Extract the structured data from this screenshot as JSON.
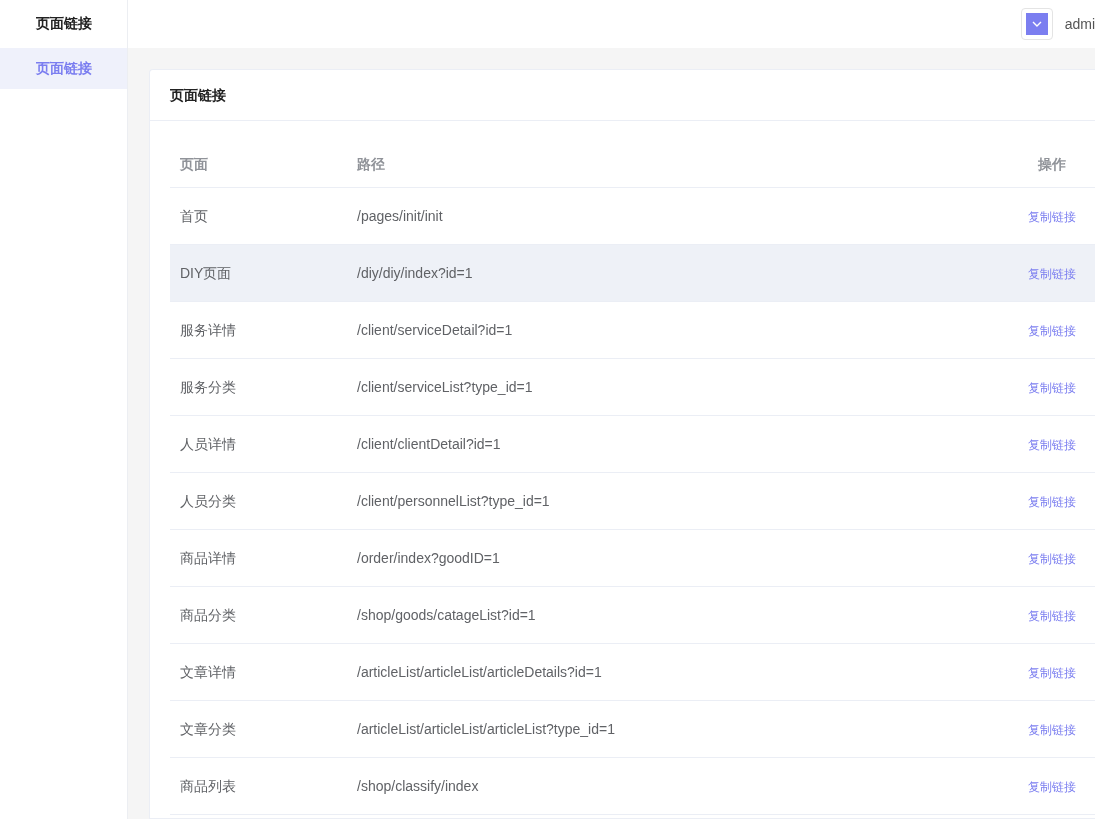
{
  "sidebar": {
    "title": "页面链接",
    "items": [
      {
        "label": "页面链接",
        "selected": true
      }
    ]
  },
  "header": {
    "user": "admi"
  },
  "card": {
    "title": "页面链接",
    "table": {
      "columns": [
        "页面",
        "路径",
        "操作"
      ],
      "rows": [
        {
          "page": "首页",
          "path": "/pages/init/init",
          "action": "复制链接",
          "selected": false
        },
        {
          "page": "DIY页面",
          "path": "/diy/diy/index?id=1",
          "action": "复制链接",
          "selected": true
        },
        {
          "page": "服务详情",
          "path": "/client/serviceDetail?id=1",
          "action": "复制链接",
          "selected": false
        },
        {
          "page": "服务分类",
          "path": "/client/serviceList?type_id=1",
          "action": "复制链接",
          "selected": false
        },
        {
          "page": "人员详情",
          "path": "/client/clientDetail?id=1",
          "action": "复制链接",
          "selected": false
        },
        {
          "page": "人员分类",
          "path": "/client/personnelList?type_id=1",
          "action": "复制链接",
          "selected": false
        },
        {
          "page": "商品详情",
          "path": "/order/index?goodID=1",
          "action": "复制链接",
          "selected": false
        },
        {
          "page": "商品分类",
          "path": "/shop/goods/catageList?id=1",
          "action": "复制链接",
          "selected": false
        },
        {
          "page": "文章详情",
          "path": "/articleList/articleList/articleDetails?id=1",
          "action": "复制链接",
          "selected": false
        },
        {
          "page": "文章分类",
          "path": "/articleList/articleList/articleList?type_id=1",
          "action": "复制链接",
          "selected": false
        },
        {
          "page": "商品列表",
          "path": "/shop/classify/index",
          "action": "复制链接",
          "selected": false
        }
      ]
    }
  }
}
